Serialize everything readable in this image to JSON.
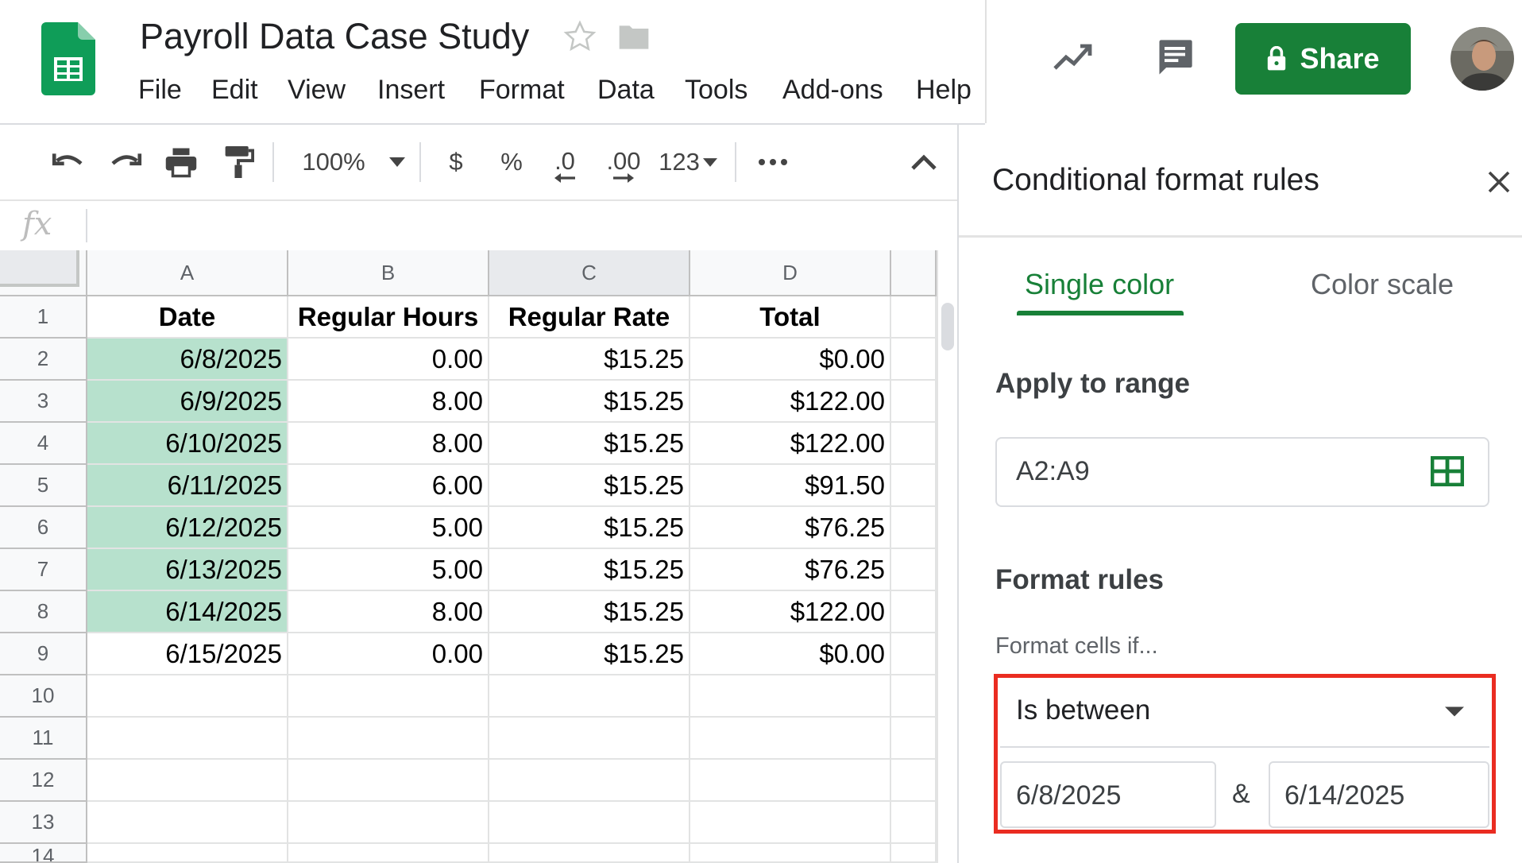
{
  "header": {
    "title": "Payroll Data Case Study",
    "menu": [
      "File",
      "Edit",
      "View",
      "Insert",
      "Format",
      "Data",
      "Tools",
      "Add-ons",
      "Help"
    ],
    "share_label": "Share",
    "brand_color": "#188038"
  },
  "toolbar": {
    "zoom": "100%",
    "currency": "$",
    "percent": "%",
    "decrease_decimal": ".0",
    "increase_decimal": ".00",
    "number_format": "123"
  },
  "formula_bar": {
    "fx": "fx",
    "value": ""
  },
  "sheet": {
    "columns": [
      "A",
      "B",
      "C",
      "D"
    ],
    "row_numbers": [
      "1",
      "2",
      "3",
      "4",
      "5",
      "6",
      "7",
      "8",
      "9",
      "10",
      "11",
      "12",
      "13",
      "14"
    ],
    "headers": [
      "Date",
      "Regular Hours",
      "Regular Rate",
      "Total"
    ],
    "rows": [
      [
        "6/8/2025",
        "0.00",
        "$15.25",
        "$0.00"
      ],
      [
        "6/9/2025",
        "8.00",
        "$15.25",
        "$122.00"
      ],
      [
        "6/10/2025",
        "8.00",
        "$15.25",
        "$122.00"
      ],
      [
        "6/11/2025",
        "6.00",
        "$15.25",
        "$91.50"
      ],
      [
        "6/12/2025",
        "5.00",
        "$15.25",
        "$76.25"
      ],
      [
        "6/13/2025",
        "5.00",
        "$15.25",
        "$76.25"
      ],
      [
        "6/14/2025",
        "8.00",
        "$15.25",
        "$122.00"
      ],
      [
        "6/15/2025",
        "0.00",
        "$15.25",
        "$0.00"
      ]
    ],
    "highlight_color": "#b7e1cd"
  },
  "panel": {
    "title": "Conditional format rules",
    "tabs": [
      "Single color",
      "Color scale"
    ],
    "active_tab": "Single color",
    "apply_to_range_label": "Apply to range",
    "range_value": "A2:A9",
    "format_rules_label": "Format rules",
    "format_cells_if_label": "Format cells if...",
    "condition": "Is between",
    "value_from": "6/8/2025",
    "value_to": "6/14/2025",
    "separator": "&",
    "highlight_frame_color": "#ea2c21"
  }
}
